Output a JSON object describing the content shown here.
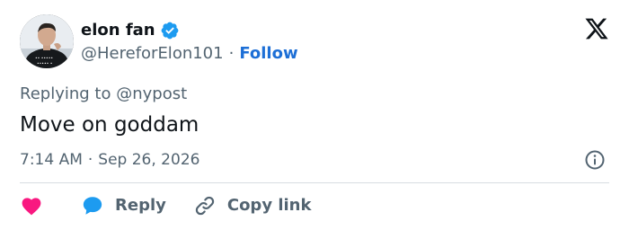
{
  "author": {
    "display_name": "elon fan",
    "handle": "@HereforElon101",
    "separator": "·",
    "follow_label": "Follow",
    "verified": true,
    "avatar": "profile-photo",
    "avatar_shirt_text": [
      "•• •••••",
      "••••• •"
    ]
  },
  "brand": {
    "logo": "x-logo"
  },
  "tweet": {
    "replying_prefix": "Replying to",
    "replying_to": "@nypost",
    "text": "Move on goddam",
    "time": "7:14 AM",
    "separator": "·",
    "date": "Sep 26, 2026"
  },
  "actions": {
    "like_icon": "heart-icon",
    "reply_label": "Reply",
    "copy_label": "Copy link"
  },
  "colors": {
    "text": "#0f1419",
    "muted": "#536471",
    "link": "#1d6fd6",
    "verified": "#1d9bf0",
    "heart": "#f91880",
    "reply_bubble": "#1d9bf0",
    "divider": "#d7dde2"
  }
}
